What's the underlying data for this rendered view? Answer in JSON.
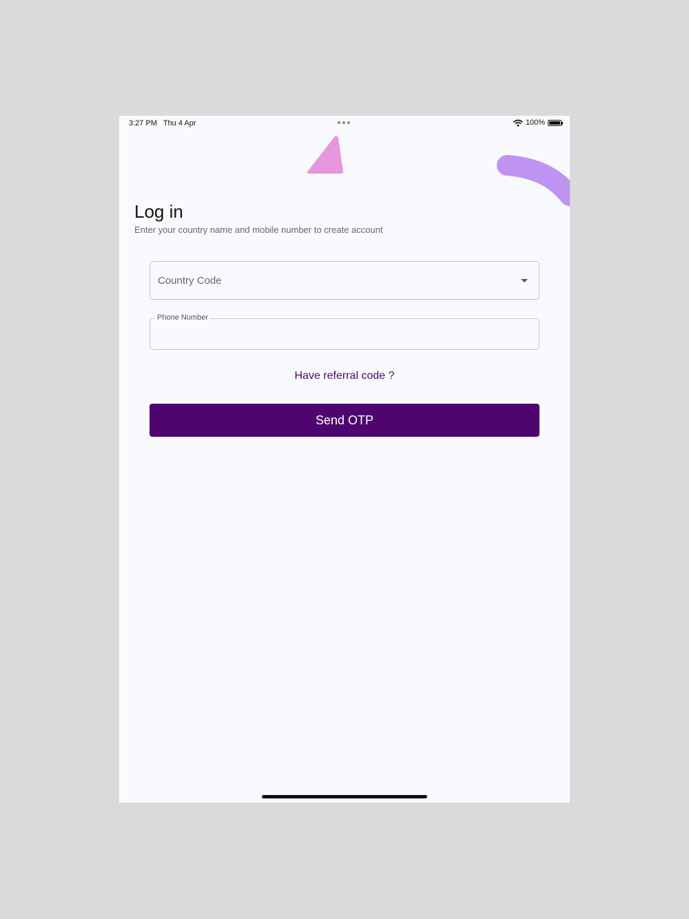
{
  "status_bar": {
    "time": "3:27 PM",
    "date": "Thu 4 Apr",
    "battery": "100%",
    "icons": [
      "wifi-icon",
      "battery-icon",
      "multitasking-dots-icon"
    ]
  },
  "login": {
    "title": "Log in",
    "subtitle": "Enter your country name and mobile number to create account",
    "country_placeholder": "Country Code",
    "phone_label": "Phone Number",
    "phone_value": "",
    "referral_link": "Have referral code ?",
    "send_button": "Send OTP"
  },
  "colors": {
    "accent": "#4f056f",
    "triangle_decoration": "#e596de",
    "arc_decoration": "#bf93f1",
    "background": "#f8fafd"
  }
}
